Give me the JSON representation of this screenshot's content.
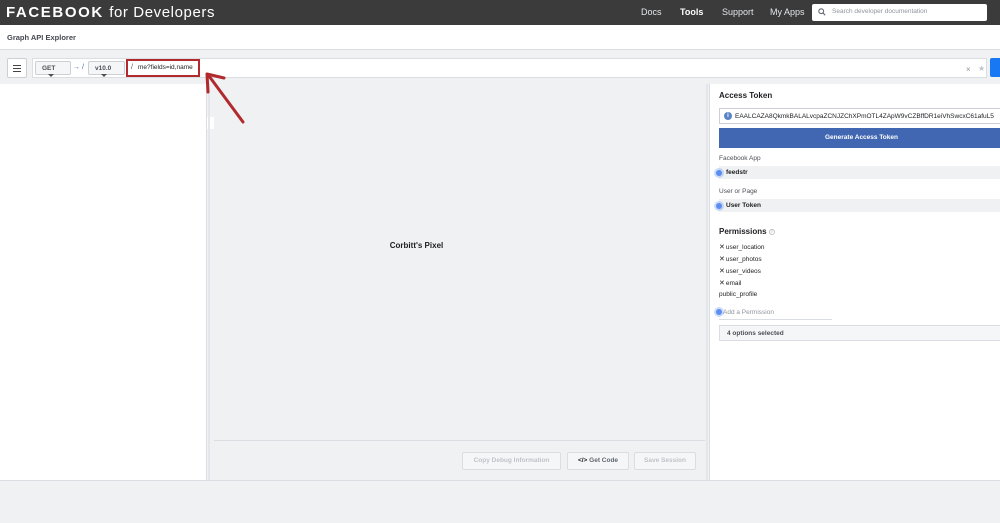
{
  "topnav": {
    "brand_main": "FACEBOOK",
    "brand_suffix": "for Developers",
    "links": [
      "Docs",
      "Tools",
      "Support",
      "My Apps"
    ],
    "search_placeholder": "Search developer documentation"
  },
  "subheader": {
    "title": "Graph API Explorer"
  },
  "query": {
    "method": "GET",
    "arrow": "→ /",
    "version": "v10.0",
    "slash": "/",
    "path": "me?fields=id,name",
    "clear": "×",
    "star": "★"
  },
  "output": {
    "text": "Corbitt's Pixel"
  },
  "footer": {
    "copy_debug": "Copy Debug Information",
    "get_code": "Get Code",
    "get_code_icon": "</>",
    "save_session": "Save Session"
  },
  "right": {
    "access_token_heading": "Access Token",
    "token_value": "EAALCAZA8QkmkBALALvcpaZCNJZChXPmOTL4ZApW9vCZBffDR1eiVhSwcxC61afuL5",
    "generate_button": "Generate Access Token",
    "facebook_app_label": "Facebook App",
    "facebook_app_value": "feedstr",
    "user_or_page_label": "User or Page",
    "user_or_page_value": "User Token",
    "permissions_heading": "Permissions",
    "permissions": [
      {
        "name": "user_location",
        "removable": true
      },
      {
        "name": "user_photos",
        "removable": true
      },
      {
        "name": "user_videos",
        "removable": true
      },
      {
        "name": "email",
        "removable": true
      },
      {
        "name": "public_profile",
        "removable": false
      }
    ],
    "add_permission_placeholder": "Add a Permission",
    "options_selected": "4 options selected"
  },
  "colors": {
    "nav_bg": "#3b3b3b",
    "accent": "#4267b2",
    "highlight_box": "#b02a2e"
  },
  "icons": [
    "hamburger-icon",
    "search-icon",
    "info-icon",
    "help-icon",
    "code-icon",
    "close-icon",
    "star-icon",
    "annotation-arrow"
  ]
}
